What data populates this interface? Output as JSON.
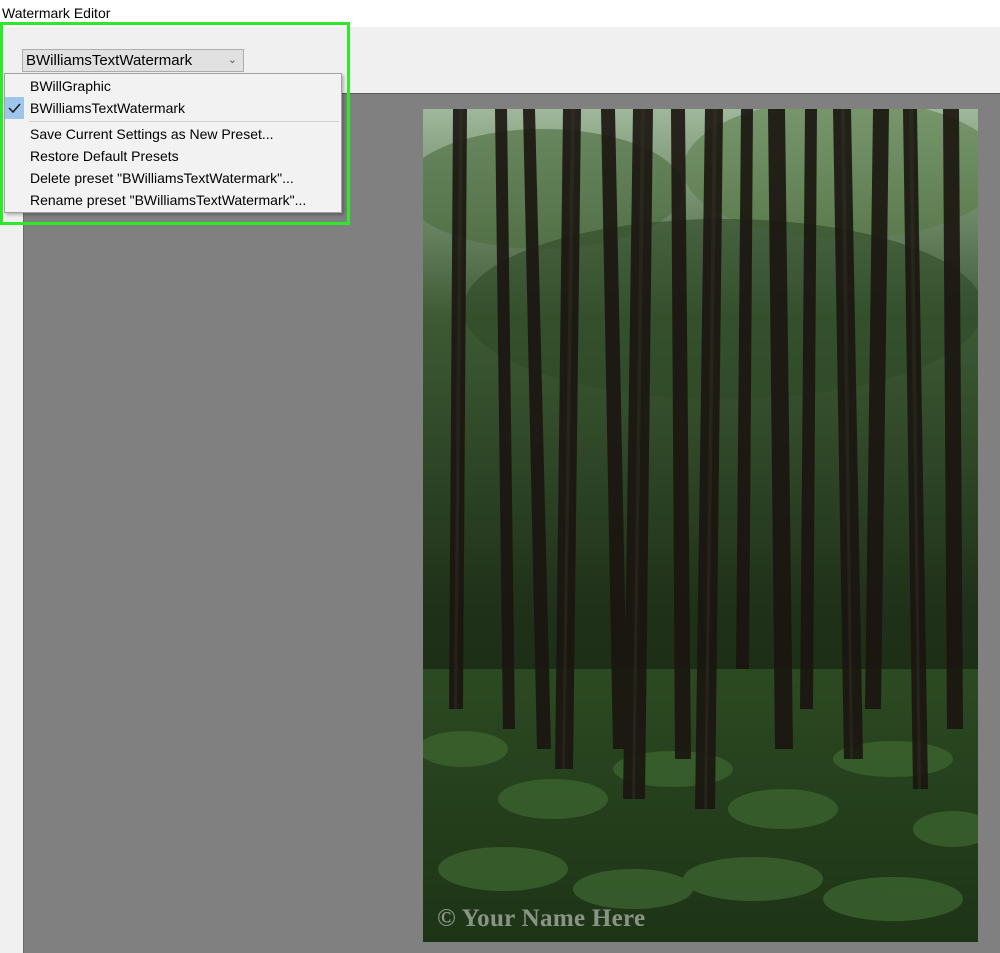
{
  "window": {
    "title": "Watermark Editor"
  },
  "preset_selector": {
    "selected": "BWilliamsTextWatermark"
  },
  "menu": {
    "presets": [
      {
        "label": "BWillGraphic",
        "checked": false
      },
      {
        "label": "BWilliamsTextWatermark",
        "checked": true
      }
    ],
    "actions": [
      {
        "label": "Save Current Settings as New Preset..."
      },
      {
        "label": "Restore Default Presets"
      },
      {
        "label": "Delete preset \"BWilliamsTextWatermark\"..."
      },
      {
        "label": "Rename preset \"BWilliamsTextWatermark\"..."
      }
    ]
  },
  "preview": {
    "watermark_text": "© Your Name Here"
  },
  "colors": {
    "highlight": "#2ee82e",
    "preview_background": "#808080",
    "check_highlight": "#9ec6ea"
  }
}
